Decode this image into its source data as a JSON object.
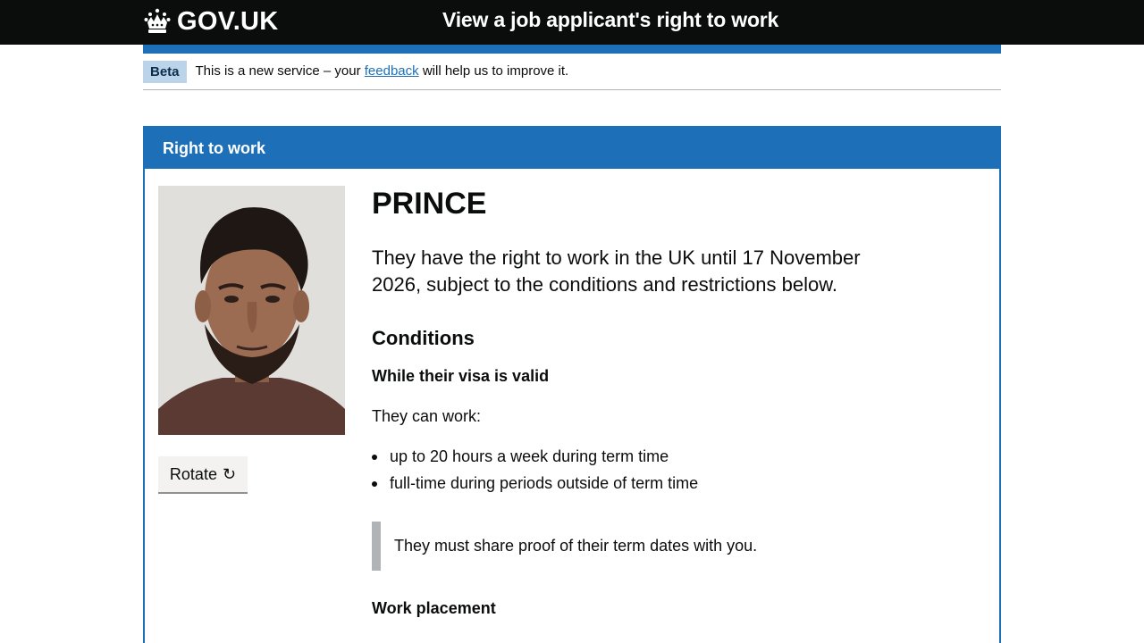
{
  "header": {
    "logo_text": "GOV.UK",
    "service_name": "View a job applicant's right to work"
  },
  "phase": {
    "tag": "Beta",
    "text_before": "This is a new service – your ",
    "link": "feedback",
    "text_after": " will help us to improve it."
  },
  "card": {
    "title": "Right to work",
    "rotate_label": "Rotate",
    "rotate_icon": "↻"
  },
  "person": {
    "name": "PRINCE",
    "summary": "They have the right to work in the UK until 17 November 2026, subject to the conditions and restrictions below."
  },
  "conditions": {
    "heading": "Conditions",
    "subheading": "While their visa is valid",
    "intro": "They can work:",
    "items": [
      "up to 20 hours a week during term time",
      "full-time during periods outside of term time"
    ],
    "inset": "They must share proof of their term dates with you.",
    "work_placement": "Work placement"
  },
  "colors": {
    "brand_blue": "#1d70b8",
    "header_black": "#0b0c0c",
    "phase_tag_bg": "#bbd4ea"
  }
}
